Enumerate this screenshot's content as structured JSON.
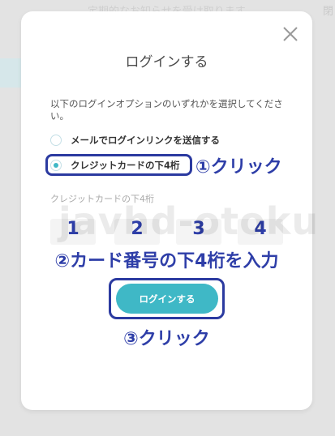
{
  "background": {
    "header_text": "定期的なお知らせを受け取ります",
    "corner_text": "閉"
  },
  "modal": {
    "title": "ログインする",
    "instruction": "以下のログインオプションのいずれかを選択してください。",
    "options": [
      {
        "label": "メールでログインリンクを送信する",
        "selected": false
      },
      {
        "label": "クレジットカードの下4桁",
        "selected": true
      }
    ],
    "card_field_label": "クレジットカードの下4桁",
    "digits": [
      "1",
      "2",
      "3",
      "4"
    ],
    "login_button": "ログインする"
  },
  "annotations": {
    "step1": "①クリック",
    "step2": "②カード番号の下4桁を入力",
    "step3": "③クリック",
    "highlight_color": "#2b3aa0"
  },
  "watermark": "javhd-otoku",
  "colors": {
    "accent": "#3fb8c6",
    "annotation": "#2e3ea8"
  },
  "icons": {
    "close": "close-icon"
  }
}
